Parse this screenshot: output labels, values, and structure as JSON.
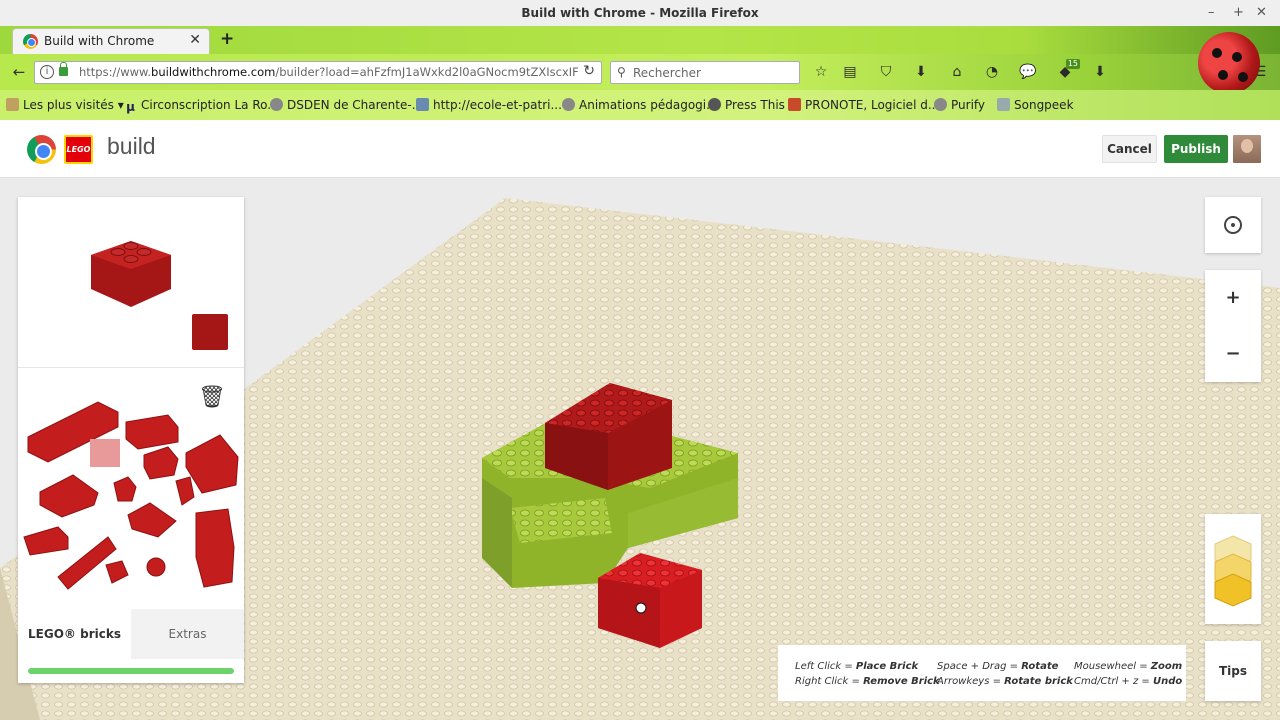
{
  "window": {
    "title": "Build with Chrome - Mozilla Firefox"
  },
  "tab": {
    "label": "Build with Chrome"
  },
  "address": {
    "url_prefix": "https://www.",
    "url_domain": "buildwithchrome.com",
    "url_rest": "/builder?load=ahFzfmJ1aWxkd2l0aGNocm9tZXIscxIFQn\\"
  },
  "search": {
    "placeholder": "Rechercher"
  },
  "toolbar": {
    "downloads_badge": "15"
  },
  "bookmarks": [
    {
      "label": "Les plus visités",
      "icon": "gear-icon"
    },
    {
      "label": "Circonscription La Ro...",
      "icon": "mu-icon"
    },
    {
      "label": "DSDEN de Charente-...",
      "icon": "globe-icon"
    },
    {
      "label": "http://ecole-et-patri...",
      "icon": "image-icon"
    },
    {
      "label": "Animations pédagogi...",
      "icon": "globe-icon"
    },
    {
      "label": "Press This",
      "icon": "wordpress-icon"
    },
    {
      "label": "PRONOTE, Logiciel d...",
      "icon": "pronote-icon"
    },
    {
      "label": "Purify",
      "icon": "globe-icon"
    },
    {
      "label": "Songpeek",
      "icon": "music-icon"
    }
  ],
  "app": {
    "logo_text": "LEGO",
    "title": "build",
    "cancel_label": "Cancel",
    "publish_label": "Publish"
  },
  "panel": {
    "selected_color": "#a51616",
    "tabs": [
      {
        "label": "LEGO® bricks",
        "active": true
      },
      {
        "label": "Extras",
        "active": false
      }
    ],
    "progress": 1.0
  },
  "controls": {
    "zoom_in": "+",
    "zoom_out": "−",
    "tips_label": "Tips"
  },
  "help": {
    "col1": [
      {
        "action": "Left Click = ",
        "result": "Place Brick"
      },
      {
        "action": "Right Click = ",
        "result": "Remove Brick"
      }
    ],
    "col2": [
      {
        "action": "Space + Drag = ",
        "result": "Rotate"
      },
      {
        "action": "Arrowkeys = ",
        "result": "Rotate brick"
      }
    ],
    "col3": [
      {
        "action": "Mousewheel = ",
        "result": "Zoom"
      },
      {
        "action": "Cmd/Ctrl + z = ",
        "result": "Undo"
      }
    ]
  },
  "colors": {
    "accent_green": "#2f8a3a",
    "brick_red": "#c8181d",
    "brick_dark_red": "#a51616",
    "brick_lime": "#9fc536",
    "baseplate": "#e8dfc6"
  }
}
